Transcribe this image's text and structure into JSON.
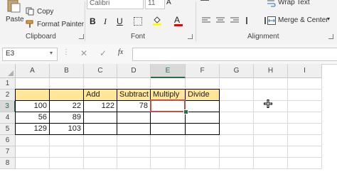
{
  "ribbon": {
    "paste_label": "Paste",
    "copy_label": "Copy",
    "format_painter_label": "Format Painter",
    "clipboard_group": "Clipboard",
    "font_name": "Calibri",
    "font_size": "11",
    "bold": "B",
    "italic": "I",
    "underline": "U",
    "font_color_letter": "A",
    "font_group": "Font",
    "wrap_text_label": "Wrap Text",
    "merge_center_label": "Merge & Center",
    "alignment_group": "Alignment"
  },
  "formula_bar": {
    "name_box": "E3",
    "fx": "fx",
    "content": ""
  },
  "columns": [
    "A",
    "B",
    "C",
    "D",
    "E",
    "F",
    "G",
    "H",
    "I"
  ],
  "selected_column": "E",
  "rows": [
    "1",
    "2",
    "3",
    "4",
    "5",
    "6",
    "7",
    "8"
  ],
  "selected_row": "3",
  "headers": {
    "add": "Add",
    "subtract": "Subtract",
    "multiply": "Multiply",
    "divide": "Divide"
  },
  "data": {
    "a3": "100",
    "b3": "22",
    "c3": "122",
    "d3": "78",
    "a4": "56",
    "b4": "89",
    "a5": "129",
    "b5": "103"
  },
  "active_cell": "E3",
  "colors": {
    "header_fill": "#ffe699",
    "active_border": "#c0504d",
    "excel_green": "#217346"
  }
}
